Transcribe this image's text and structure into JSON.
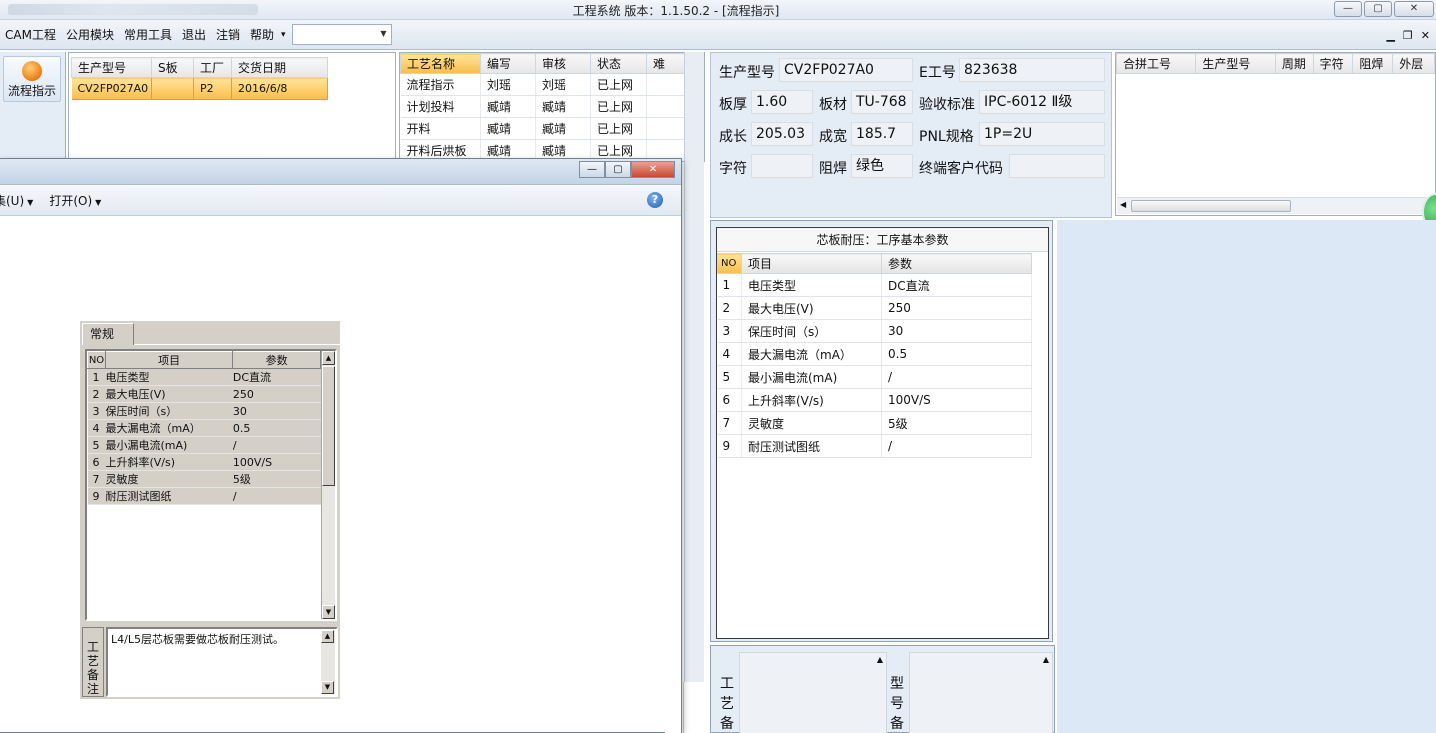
{
  "window": {
    "title": "工程系统   版本：1.1.50.2 - [流程指示]",
    "min": "—",
    "max": "▢",
    "close": "✕"
  },
  "menu": {
    "items": [
      "CAM工程",
      "公用模块",
      "常用工具",
      "退出",
      "注销",
      "帮助"
    ],
    "help_arrow": "▾",
    "combo_value": ""
  },
  "left_tool": {
    "label": "流程指示"
  },
  "orders": {
    "headers": [
      "生产型号",
      "S板",
      "工厂",
      "交货日期"
    ],
    "rows": [
      [
        "CV2FP027A0",
        "",
        "P2",
        "2016/6/8"
      ]
    ]
  },
  "process": {
    "headers": [
      "工艺名称",
      "编写",
      "审核",
      "状态",
      "难"
    ],
    "rows": [
      [
        "流程指示",
        "刘瑶",
        "刘瑶",
        "已上网",
        ""
      ],
      [
        "计划投料",
        "臧靖",
        "臧靖",
        "已上网",
        ""
      ],
      [
        "开料",
        "臧靖",
        "臧靖",
        "已上网",
        ""
      ],
      [
        "开料后烘板",
        "臧靖",
        "臧靖",
        "已上网",
        ""
      ]
    ]
  },
  "info": {
    "model_label": "生产型号",
    "model": "CV2FP027A0",
    "eno_label": "E工号",
    "eno": "823638",
    "thick_label": "板厚",
    "thick": "1.60",
    "mat_label": "板材",
    "mat": "TU-768",
    "std_label": "验收标准",
    "std": "IPC-6012 Ⅱ级",
    "len_label": "成长",
    "len": "205.03",
    "wid_label": "成宽",
    "wid": "185.7",
    "pnl_label": "PNL规格",
    "pnl": "1P=2U",
    "char_label": "字符",
    "char": "",
    "mask_label": "阻焊",
    "mask": "绿色",
    "cust_label": "终端客户代码",
    "cust": ""
  },
  "merge": {
    "headers": [
      "合拼工号",
      "生产型号",
      "周期",
      "字符",
      "阻焊",
      "外层"
    ]
  },
  "params": {
    "title": "芯板耐压：工序基本参数",
    "headers": [
      "NO",
      "项目",
      "参数"
    ],
    "rows": [
      [
        "1",
        "电压类型",
        "DC直流"
      ],
      [
        "2",
        "最大电压(V)",
        "250"
      ],
      [
        "3",
        "保压时间（s）",
        "30"
      ],
      [
        "4",
        "最大漏电流（mA）",
        "0.5"
      ],
      [
        "5",
        "最小漏电流(mA)",
        "/"
      ],
      [
        "6",
        "上升斜率(V/s)",
        "100V/S"
      ],
      [
        "7",
        "灵敏度",
        "5级"
      ],
      [
        "9",
        "耐压测试图纸",
        "/"
      ]
    ]
  },
  "bottom": {
    "left_label": "工艺备",
    "right_label": "型号备"
  },
  "dialog": {
    "toolbar": [
      "集(U)",
      "打开(O)"
    ],
    "help": "?",
    "tab": "常规",
    "grid_headers": [
      "NO",
      "项目",
      "参数"
    ],
    "memo_label": "工艺备注",
    "memo_text": "L4/L5层芯板需要做芯板耐压测试。"
  },
  "colors": {
    "selected_row": "#f9bd4a",
    "panel_bg": "#e4ecf6",
    "classic_bg": "#d4d0c8"
  }
}
